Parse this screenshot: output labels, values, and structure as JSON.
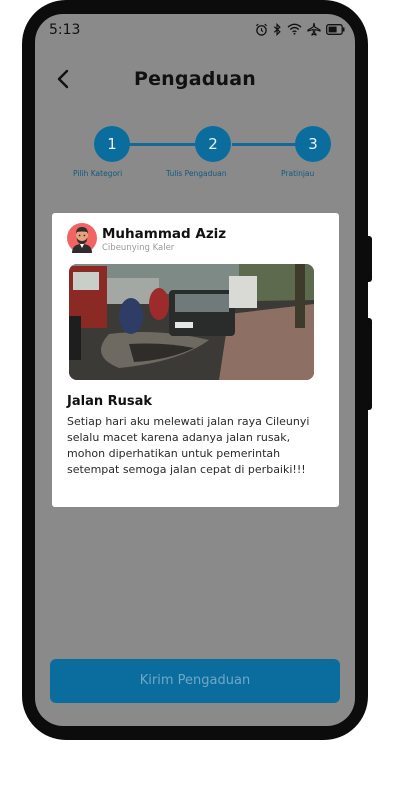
{
  "status_bar": {
    "time": "5:13",
    "icons": [
      "alarm-icon",
      "bluetooth-icon",
      "wifi-icon",
      "airplane-icon",
      "battery-icon"
    ]
  },
  "header": {
    "title": "Pengaduan",
    "back_icon": "chevron-left-icon"
  },
  "stepper": {
    "steps": [
      {
        "number": "1",
        "label": "Pilih Kategori"
      },
      {
        "number": "2",
        "label": "Tulis Pengaduan"
      },
      {
        "number": "3",
        "label": "Pratinjau"
      }
    ]
  },
  "post": {
    "user_name": "Muhammad Aziz",
    "location": "Cibeunying Kaler",
    "title": "Jalan Rusak",
    "body": "Setiap hari aku melewati jalan raya Cileunyi selalu macet karena adanya jalan rusak, mohon diperhatikan untuk pemerintah setempat semoga jalan cepat di perbaiki!!!"
  },
  "actions": {
    "submit_label": "Kirim Pengaduan"
  },
  "colors": {
    "primary": "#0b6d9e",
    "overlay": "#8a8a8a",
    "card": "#ffffff",
    "frame": "#0c0c0c"
  }
}
